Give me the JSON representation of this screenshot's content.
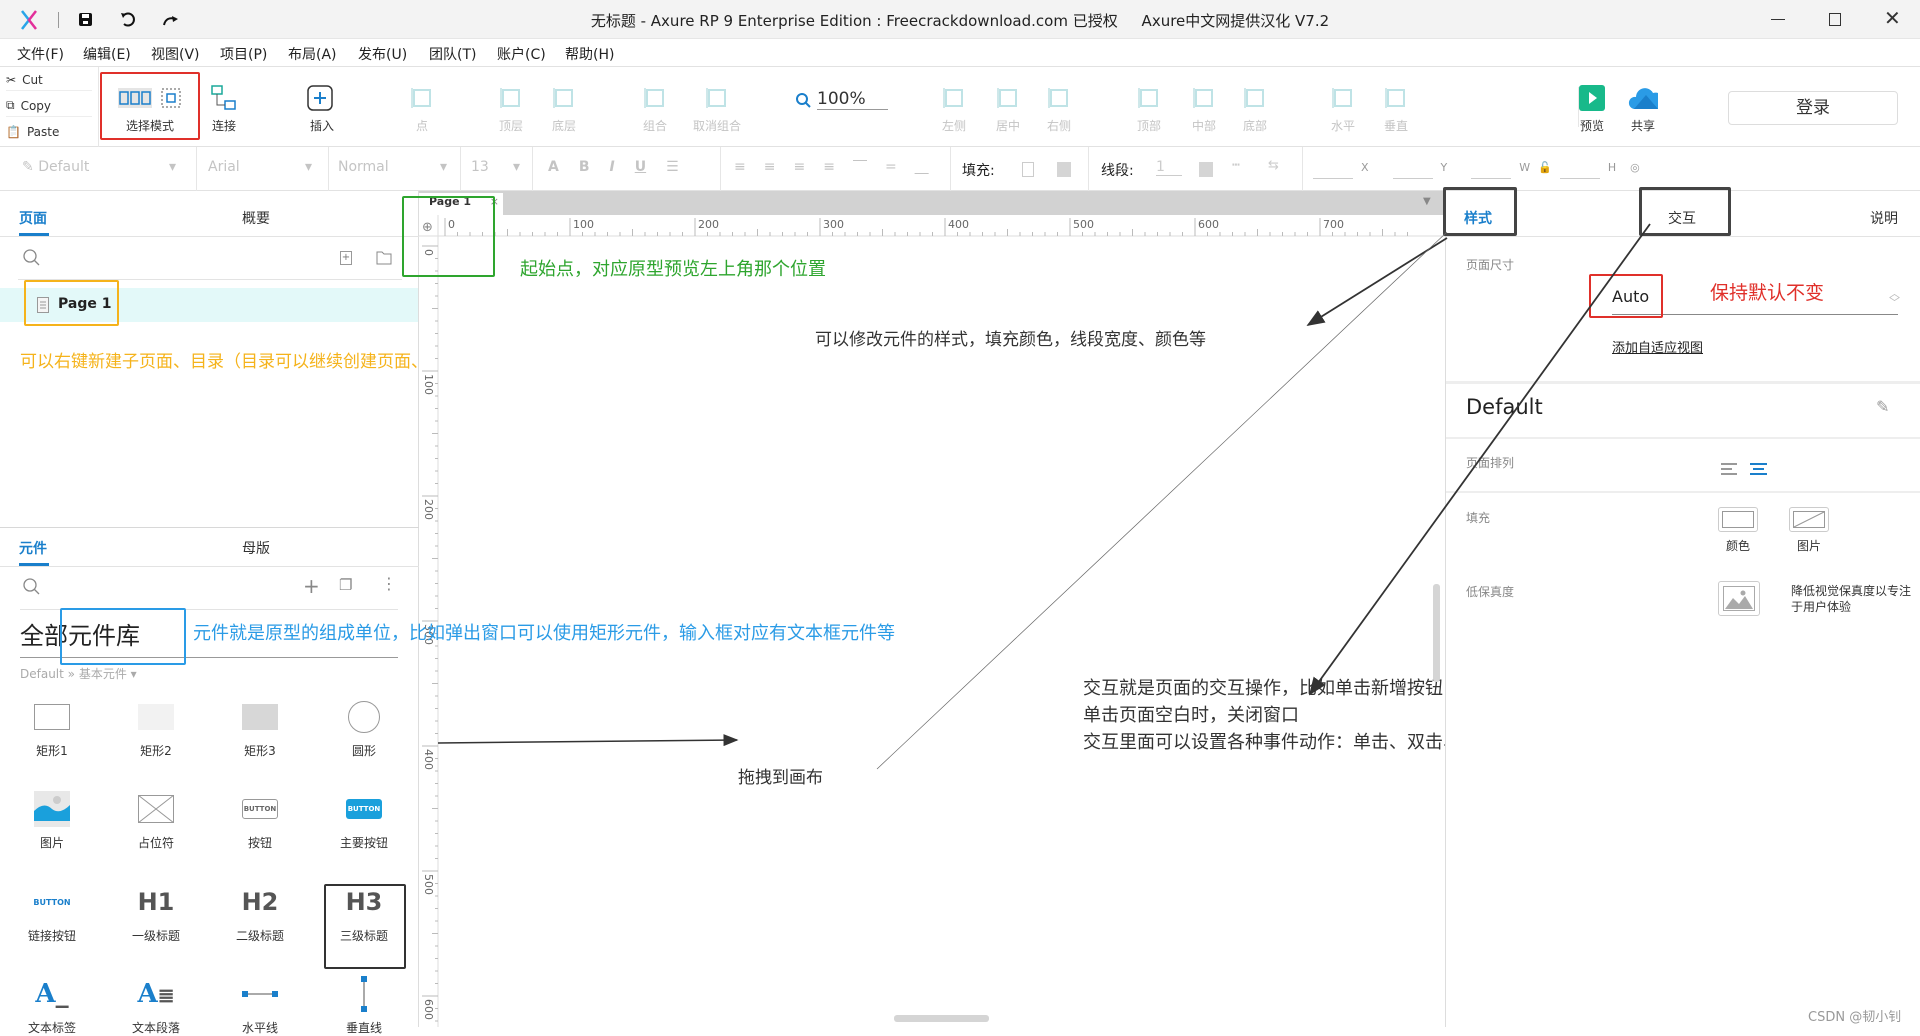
{
  "window": {
    "title": "无标题 - Axure RP 9 Enterprise Edition : Freecrackdownload.com 已授权     Axure中文网提供汉化 V7.2"
  },
  "menu": [
    "文件(F)",
    "编辑(E)",
    "视图(V)",
    "项目(P)",
    "布局(A)",
    "发布(U)",
    "团队(T)",
    "账户(C)",
    "帮助(H)"
  ],
  "clipboard": {
    "cut": "Cut",
    "copy": "Copy",
    "paste": "Paste"
  },
  "toolbar": {
    "items": [
      {
        "label": "选择模式",
        "icon": "select-mode-icon",
        "enabled": true
      },
      {
        "label": "连接",
        "icon": "connect-icon",
        "enabled": true
      },
      {
        "label": "插入",
        "icon": "insert-icon",
        "enabled": true
      },
      {
        "label": "点",
        "icon": "point-icon",
        "enabled": false
      },
      {
        "label": "顶层",
        "icon": "bring-front-icon",
        "enabled": false
      },
      {
        "label": "底层",
        "icon": "send-back-icon",
        "enabled": false
      },
      {
        "label": "组合",
        "icon": "group-icon",
        "enabled": false
      },
      {
        "label": "取消组合",
        "icon": "ungroup-icon",
        "enabled": false
      },
      {
        "label": "左侧",
        "icon": "align-left-icon",
        "enabled": false
      },
      {
        "label": "居中",
        "icon": "align-center-icon",
        "enabled": false
      },
      {
        "label": "右侧",
        "icon": "align-right-icon",
        "enabled": false
      },
      {
        "label": "顶部",
        "icon": "align-top-icon",
        "enabled": false
      },
      {
        "label": "中部",
        "icon": "align-middle-icon",
        "enabled": false
      },
      {
        "label": "底部",
        "icon": "align-bottom-icon",
        "enabled": false
      },
      {
        "label": "水平",
        "icon": "distribute-horizontal-icon",
        "enabled": false
      },
      {
        "label": "垂直",
        "icon": "distribute-vertical-icon",
        "enabled": false
      },
      {
        "label": "预览",
        "icon": "preview-icon",
        "enabled": true
      },
      {
        "label": "共享",
        "icon": "share-cloud-icon",
        "enabled": true
      }
    ],
    "zoom": "100%",
    "login": "登录"
  },
  "format": {
    "style": "Default",
    "font": "Arial",
    "weight": "Normal",
    "size": "13",
    "fill_label": "填充:",
    "stroke_label": "线段:",
    "stroke_value": "1",
    "x": "X",
    "y": "Y",
    "w": "W",
    "h": "H"
  },
  "pages_panel": {
    "tabs": [
      "页面",
      "概要"
    ],
    "active_tab": "页面",
    "pages": [
      "Page 1"
    ]
  },
  "widgets_panel": {
    "tabs": [
      "元件",
      "母版"
    ],
    "active_tab": "元件",
    "library": "全部元件库",
    "breadcrumb": "Default » 基本元件 ▾",
    "widgets": [
      "矩形1",
      "矩形2",
      "矩形3",
      "圆形",
      "图片",
      "占位符",
      "按钮",
      "主要按钮",
      "链接按钮",
      "一级标题",
      "二级标题",
      "三级标题",
      "文本标签",
      "文本段落",
      "水平线",
      "垂直线"
    ]
  },
  "canvas": {
    "tab": "Page 1",
    "ruler_x": [
      "0",
      "100",
      "200",
      "300",
      "400",
      "500",
      "600",
      "700"
    ],
    "ruler_y": [
      "0",
      "100",
      "200",
      "300",
      "400",
      "500",
      "600"
    ]
  },
  "annotations": {
    "origin": "起始点，对应原型预览左上角那个位置",
    "pages": "可以右键新建子页面、目录（目录可以继续创建页面、目录）",
    "style": "可以修改元件的样式，填充颜色，线段宽度、颜色等",
    "widgets": "元件就是原型的组成单位，比如弹出窗口可以使用矩形元件，输入框对应有文本框元件等",
    "drag": "拖拽到画布",
    "interaction": [
      "交互就是页面的交互操作，比如单击新增按钮，弹出窗口，",
      "单击页面空白时，关闭窗口",
      "交互里面可以设置各种事件动作：单击、双击、右击、选中等"
    ],
    "keep_default": "保持默认不变"
  },
  "inspector": {
    "tabs": [
      "样式",
      "交互",
      "说明"
    ],
    "active_tab": "样式",
    "page_size_label": "页面尺寸",
    "page_size": "Auto",
    "adaptive_link": "添加自适应视图",
    "style_name": "Default",
    "arrange_label": "页面排列",
    "fill_label": "填充",
    "fill_color": "颜色",
    "fill_image": "图片",
    "lowfi_label": "低保真度",
    "lowfi_desc": [
      "降低视觉保真度以专注",
      "于用户体验"
    ]
  },
  "watermark": "CSDN @韧小钊",
  "colors": {
    "accent": "#1a7fcb",
    "annot_red": "#e0302a",
    "annot_green": "#2ea52e",
    "annot_yellow": "#f5b31b",
    "annot_blue": "#2a9be6",
    "annot_dark": "#444444"
  }
}
